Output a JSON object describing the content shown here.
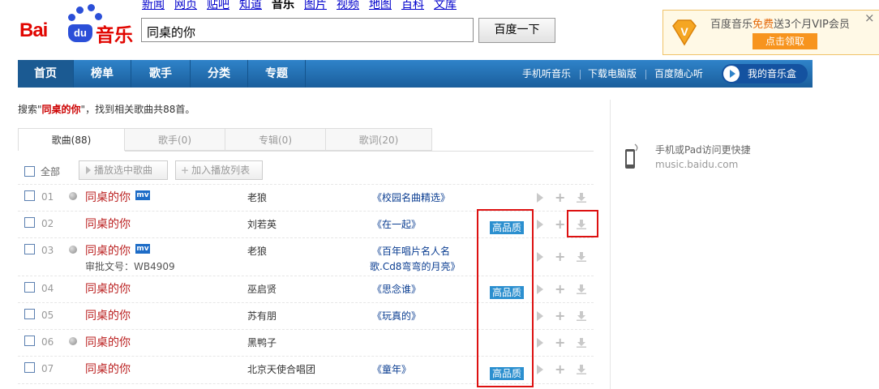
{
  "brand": {
    "bai": "Bai",
    "du": "du",
    "music": "音乐"
  },
  "topnav": [
    "新闻",
    "网页",
    "贴吧",
    "知道",
    "音乐",
    "图片",
    "视频",
    "地图",
    "百科",
    "文库"
  ],
  "topnav_active": "音乐",
  "search": {
    "value": "同桌的你",
    "button": "百度一下"
  },
  "vip": {
    "text_pre": "百度音乐",
    "text_free": "免费",
    "text_post": "送3个月VIP会员",
    "button": "点击领取",
    "close": "×"
  },
  "mainnav": [
    "首页",
    "榜单",
    "歌手",
    "分类",
    "专题"
  ],
  "rightnav": [
    "手机听音乐",
    "下载电脑版",
    "百度随心听"
  ],
  "mybox": "我的音乐盒",
  "summary": {
    "pre": "搜索\"",
    "keyword": "同桌的你",
    "post": "\"，找到相关歌曲共88首。"
  },
  "tabs": [
    "歌曲(88)",
    "歌手(0)",
    "专辑(0)",
    "歌词(20)"
  ],
  "toolbar": {
    "all": "全部",
    "play": "播放选中歌曲",
    "add": "加入播放列表"
  },
  "mobile": {
    "text": "手机或Pad访问更快捷",
    "domain": "music.baidu.com"
  },
  "hq_label": "高品质",
  "mv_label": "mv",
  "rows": [
    {
      "num": "01",
      "title": "同桌的你",
      "singer": "老狼",
      "album": "《校园名曲精选》",
      "hq": false,
      "mv": true,
      "online": true
    },
    {
      "num": "02",
      "title": "同桌的你",
      "singer": "刘若英",
      "album": "《在一起》",
      "hq": true,
      "mv": false,
      "online": false
    },
    {
      "num": "03",
      "title": "同桌的你",
      "singer": "老狼",
      "album": "《百年唱片名人名",
      "album2": "歌.Cd8弯弯的月亮》",
      "approval": "审批文号：WB4909",
      "hq": false,
      "mv": true,
      "online": true
    },
    {
      "num": "04",
      "title": "同桌的你",
      "singer": "巫启贤",
      "album": "《思念谁》",
      "hq": true,
      "mv": false,
      "online": false
    },
    {
      "num": "05",
      "title": "同桌的你",
      "singer": "苏有朋",
      "album": "《玩真的》",
      "hq": false,
      "mv": false,
      "online": false
    },
    {
      "num": "06",
      "title": "同桌的你",
      "singer": "黑鸭子",
      "album": "",
      "hq": false,
      "mv": false,
      "online": true
    },
    {
      "num": "07",
      "title": "同桌的你",
      "singer": "北京天使合唱团",
      "album": "《童年》",
      "hq": true,
      "mv": false,
      "online": false
    }
  ],
  "colors": {
    "brand_red": "#e10601",
    "brand_blue": "#2b4fd8",
    "nav_blue": "#2f83c9",
    "song_red": "#b22",
    "hq_blue": "#2b8fcf",
    "highlight": "#d11"
  }
}
